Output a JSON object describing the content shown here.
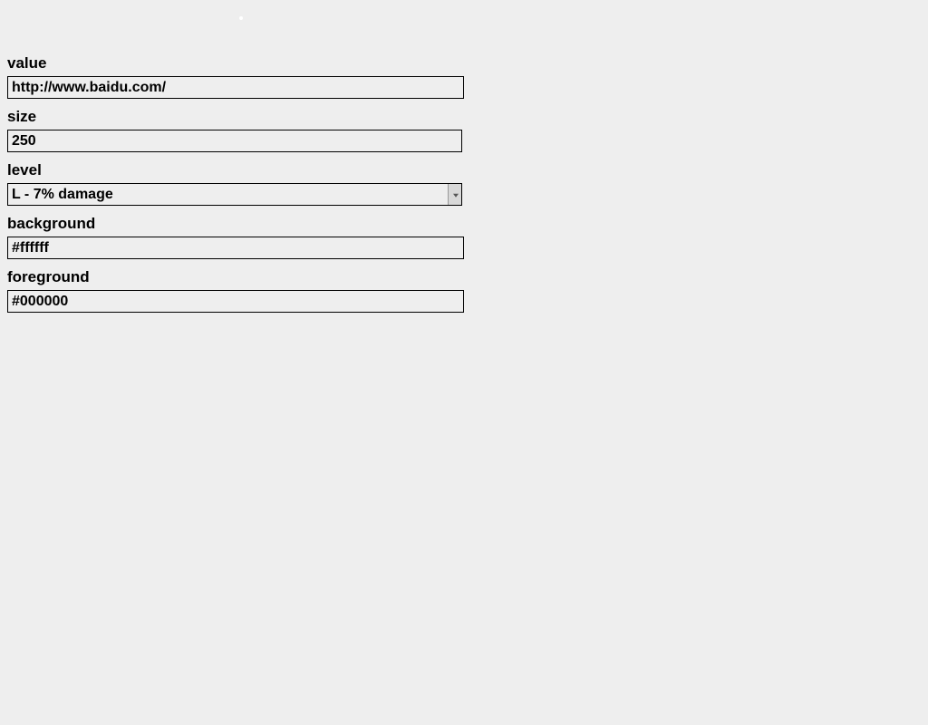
{
  "form": {
    "value": {
      "label": "value",
      "value": "http://www.baidu.com/"
    },
    "size": {
      "label": "size",
      "value": "250"
    },
    "level": {
      "label": "level",
      "selected": "L - 7% damage"
    },
    "background": {
      "label": "background",
      "value": "#ffffff"
    },
    "foreground": {
      "label": "foreground",
      "value": "#000000"
    }
  }
}
